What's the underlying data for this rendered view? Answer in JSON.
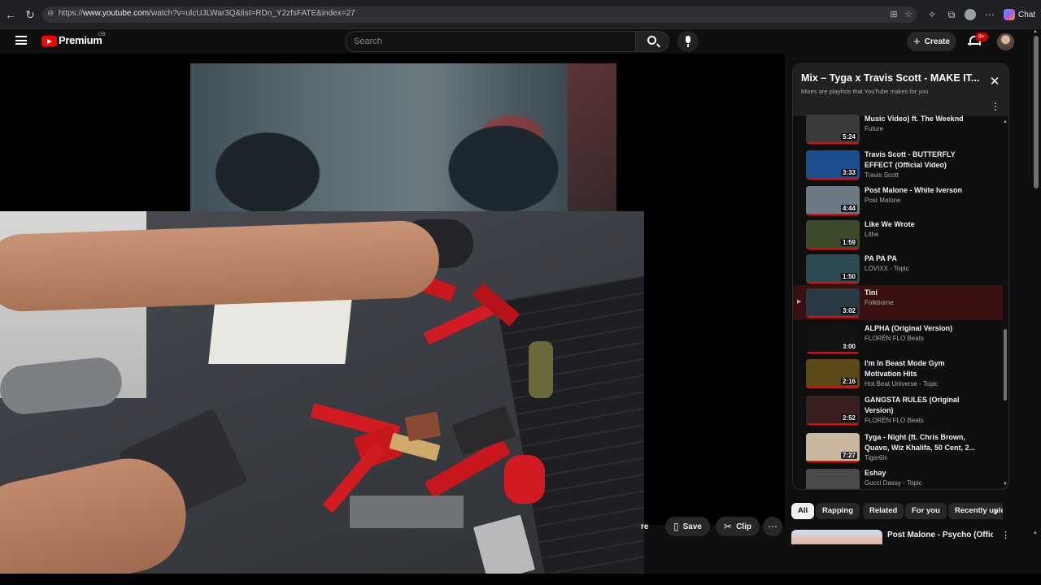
{
  "browser": {
    "url_prefix": "https://",
    "url_domain": "www.youtube.com",
    "url_path": "/watch?v=ulcUJLWar3Q&list=RDn_Y2zfsFATE&index=27",
    "chat_label": "Chat"
  },
  "masthead": {
    "brand": "Premium",
    "region": "GB",
    "search_placeholder": "Search",
    "create_label": "Create",
    "notification_count": "9+"
  },
  "actions": {
    "share_label": "re",
    "save_label": "Save",
    "clip_label": "Clip"
  },
  "playlist": {
    "title": "Mix – Tyga x Travis Scott - MAKE IT...",
    "subtitle": "Mixes are playlists that YouTube makes for you",
    "items": [
      {
        "title": "Music Video) ft. The Weeknd",
        "channel": "Future",
        "duration": "5:24",
        "active": false,
        "thumb": "#3b3b3b"
      },
      {
        "title": "Travis Scott - BUTTERFLY EFFECT (Official Video)",
        "channel": "Travis Scott",
        "duration": "3:33",
        "active": false,
        "thumb": "#1c4d8c"
      },
      {
        "title": "Post Malone - White Iverson",
        "channel": "Post Malone",
        "duration": "4:44",
        "active": false,
        "thumb": "#6c7a86"
      },
      {
        "title": "Like We Wrote",
        "channel": "Lithe",
        "duration": "1:59",
        "active": false,
        "thumb": "#3c4a2a"
      },
      {
        "title": "PA PA PA",
        "channel": "LOVIXX - Topic",
        "duration": "1:50",
        "active": false,
        "thumb": "#2c4a52"
      },
      {
        "title": "Tini",
        "channel": "Folkborne",
        "duration": "3:02",
        "active": true,
        "thumb": "#2a3a44"
      },
      {
        "title": "ALPHA (Original Version)",
        "channel": "FLORÉN FLO Beats",
        "duration": "3:00",
        "active": false,
        "thumb": "#121212"
      },
      {
        "title": "I'm In Beast Mode Gym Motivation Hits",
        "channel": "Hot Beat Universe - Topic",
        "duration": "2:16",
        "active": false,
        "thumb": "#5a4a1a"
      },
      {
        "title": "GANGSTA RULES (Original Version)",
        "channel": "FLORÉN FLO Beats",
        "duration": "2:52",
        "active": false,
        "thumb": "#3a1f1f"
      },
      {
        "title": "Tyga - Night (ft. Chris Brown, Quavo, Wiz Khalifa, 50 Cent, 2...",
        "channel": "Tiger6ix",
        "duration": "7:27",
        "active": false,
        "thumb": "#c9b7a0"
      },
      {
        "title": "Eshay",
        "channel": "Gucci Dassy - Topic",
        "duration": "",
        "active": false,
        "thumb": "#4a4a4a"
      }
    ]
  },
  "chips": [
    "All",
    "Rapping",
    "Related",
    "For you",
    "Recently uploaded"
  ],
  "recommended": {
    "first_title": "Post Malone - Psycho (Official"
  },
  "colors": {
    "brand_red": "#ff0000",
    "active_row": "#3a0f12",
    "background": "#0f0f0f"
  }
}
